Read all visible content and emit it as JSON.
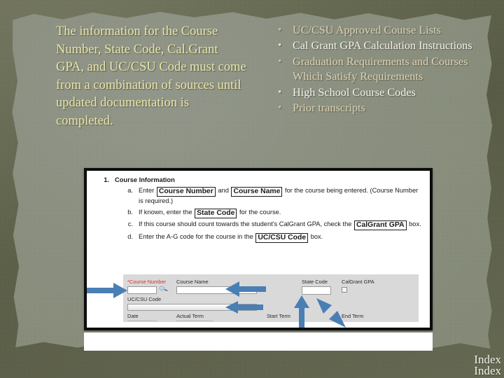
{
  "slide": {
    "background_color": "#6e7159",
    "paper_color": "#8a8f7f"
  },
  "left_column": {
    "text": "The information for the Course Number, State Code, Cal.Grant GPA, and UC/CSU Code must come from a combination of sources until updated documentation is completed.",
    "color": "#eae6a9"
  },
  "right_column": {
    "bullet_glyph": "•",
    "bullets": [
      {
        "label": "UC/CSU Approved Course Lists",
        "color": "#ded4b4"
      },
      {
        "label": "Cal Grant GPA Calculation Instructions",
        "color": "#f4f3ee"
      },
      {
        "label": "Graduation Requirements and Courses Which Satisfy Requirements",
        "color": "#ded4b4"
      },
      {
        "label": "High School Course Codes",
        "color": "#f4f3ee"
      },
      {
        "label": "Prior transcripts",
        "color": "#ded4b4"
      }
    ]
  },
  "document_image": {
    "heading": {
      "number": "1.",
      "text": "Course Information"
    },
    "items": [
      {
        "number": "a.",
        "segments": [
          {
            "type": "text",
            "value": "Enter "
          },
          {
            "type": "boxed",
            "value": "Course Number"
          },
          {
            "type": "text",
            "value": " and "
          },
          {
            "type": "boxed",
            "value": "Course Name"
          },
          {
            "type": "text",
            "value": " for the course being entered. (Course Number is required.)"
          }
        ]
      },
      {
        "number": "b.",
        "segments": [
          {
            "type": "text",
            "value": "If known, enter the "
          },
          {
            "type": "boxed",
            "value": "State Code"
          },
          {
            "type": "text",
            "value": " for the course."
          }
        ]
      },
      {
        "number": "c.",
        "segments": [
          {
            "type": "text",
            "value": "If this course should count towards the student's CalGrant GPA, check the "
          },
          {
            "type": "boxed",
            "value": "CalGrant GPA"
          },
          {
            "type": "text",
            "value": " box."
          }
        ]
      },
      {
        "number": "d.",
        "segments": [
          {
            "type": "text",
            "value": "Enter the A-G code for the course in the "
          },
          {
            "type": "boxed",
            "value": "UC/CSU Code"
          },
          {
            "type": "text",
            "value": " box."
          }
        ]
      }
    ],
    "form_mock": {
      "labels": {
        "course_number": "*Course Number",
        "course_name": "Course Name",
        "state_code": "State Code",
        "calgrant_gpa": "CalGrant GPA",
        "uc_csu_code": "UC/CSU Code",
        "date": "Date",
        "actual_term": "Actual Term",
        "start_term": "Start Term",
        "end_term": "End Term"
      },
      "values": {
        "course_number": "",
        "course_name": "",
        "state_code": "",
        "uc_csu_code": "",
        "calgrant_gpa_checked": false
      },
      "required_marker_color": "#d83232",
      "arrow_color": "#4a7fb5",
      "arrow_count": 4
    }
  },
  "index_links": {
    "first": "Index",
    "second": "Index"
  }
}
